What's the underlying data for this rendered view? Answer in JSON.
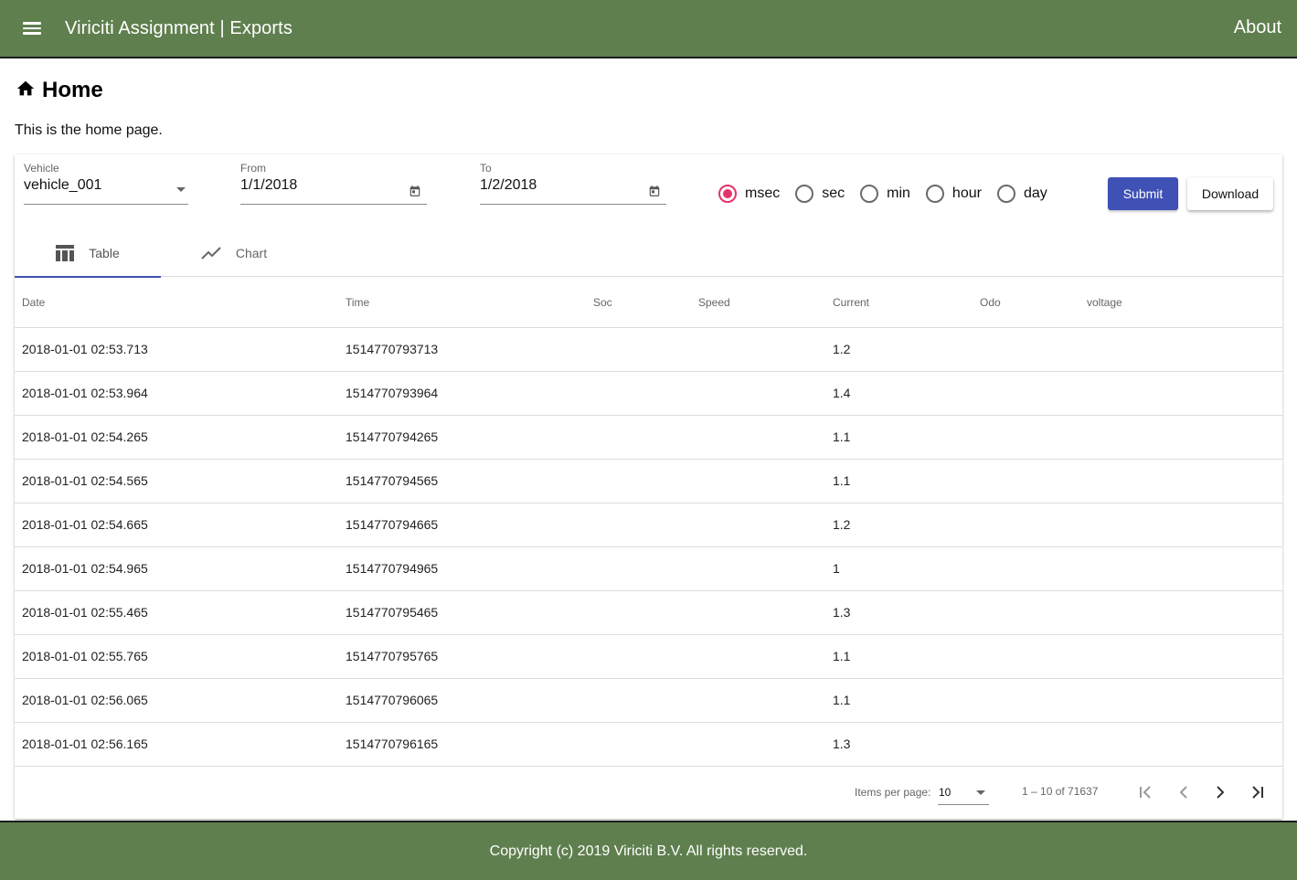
{
  "header": {
    "title": "Viriciti Assignment | Exports",
    "about_label": "About"
  },
  "page": {
    "title": "Home",
    "intro": "This is the home page."
  },
  "filters": {
    "vehicle": {
      "label": "Vehicle",
      "value": "vehicle_001"
    },
    "from": {
      "label": "From",
      "value": "1/1/2018"
    },
    "to": {
      "label": "To",
      "value": "1/2/2018"
    },
    "units": [
      {
        "label": "msec",
        "checked": true
      },
      {
        "label": "sec",
        "checked": false
      },
      {
        "label": "min",
        "checked": false
      },
      {
        "label": "hour",
        "checked": false
      },
      {
        "label": "day",
        "checked": false
      }
    ],
    "submit_label": "Submit",
    "download_label": "Download"
  },
  "tabs": [
    {
      "label": "Table",
      "icon": "table-icon",
      "active": true
    },
    {
      "label": "Chart",
      "icon": "chart-line-icon",
      "active": false
    }
  ],
  "table": {
    "columns": [
      "Date",
      "Time",
      "Soc",
      "Speed",
      "Current",
      "Odo",
      "voltage"
    ],
    "rows": [
      [
        "2018-01-01 02:53.713",
        "1514770793713",
        "",
        "",
        "1.2",
        "",
        ""
      ],
      [
        "2018-01-01 02:53.964",
        "1514770793964",
        "",
        "",
        "1.4",
        "",
        ""
      ],
      [
        "2018-01-01 02:54.265",
        "1514770794265",
        "",
        "",
        "1.1",
        "",
        ""
      ],
      [
        "2018-01-01 02:54.565",
        "1514770794565",
        "",
        "",
        "1.1",
        "",
        ""
      ],
      [
        "2018-01-01 02:54.665",
        "1514770794665",
        "",
        "",
        "1.2",
        "",
        ""
      ],
      [
        "2018-01-01 02:54.965",
        "1514770794965",
        "",
        "",
        "1",
        "",
        ""
      ],
      [
        "2018-01-01 02:55.465",
        "1514770795465",
        "",
        "",
        "1.3",
        "",
        ""
      ],
      [
        "2018-01-01 02:55.765",
        "1514770795765",
        "",
        "",
        "1.1",
        "",
        ""
      ],
      [
        "2018-01-01 02:56.065",
        "1514770796065",
        "",
        "",
        "1.1",
        "",
        ""
      ],
      [
        "2018-01-01 02:56.165",
        "1514770796165",
        "",
        "",
        "1.3",
        "",
        ""
      ]
    ]
  },
  "paginator": {
    "items_per_page_label": "Items per page:",
    "items_per_page": "10",
    "range_label": "1 – 10 of 71637"
  },
  "footer": {
    "copyright": "Copyright (c) 2019 Viriciti B.V. All rights reserved."
  },
  "colors": {
    "toolbar": "#5f7f4e",
    "primary": "#3f51b5",
    "accent": "#e5336a"
  }
}
